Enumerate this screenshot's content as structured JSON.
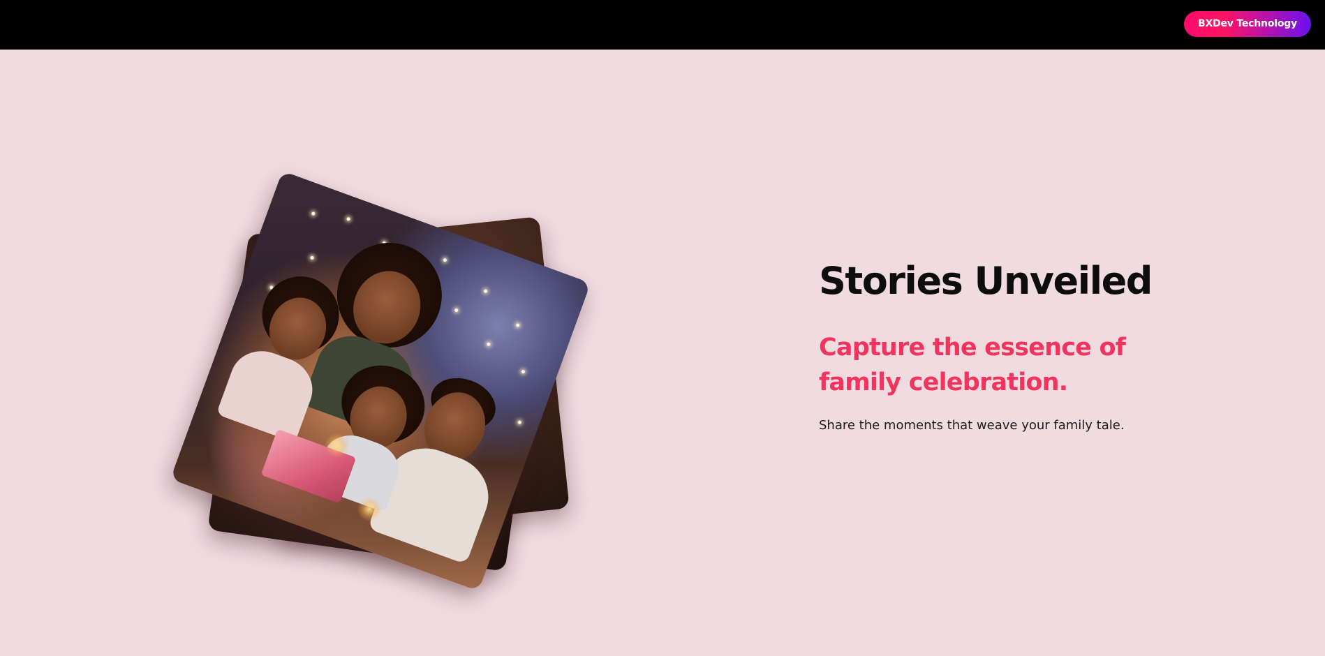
{
  "header": {
    "brand_button_label": "BXDev Technology"
  },
  "hero": {
    "title": "Stories Unveiled",
    "subtitle": "Capture the essence of family celebration.",
    "description": "Share the moments that weave your family tale.",
    "image_alt": "Illustration of a smiling family gathered around a gift with candles"
  },
  "carousel": {
    "slide_count": 3,
    "active_index": 0,
    "dots": [
      {
        "state": "active"
      },
      {
        "state": "inactive"
      },
      {
        "state": "inactive"
      }
    ]
  },
  "colors": {
    "background": "#f0dbe1",
    "topbar": "#000000",
    "accent": "#f0345e",
    "brand_gradient_start": "#ff0a6c",
    "brand_gradient_end": "#6a12f0"
  }
}
